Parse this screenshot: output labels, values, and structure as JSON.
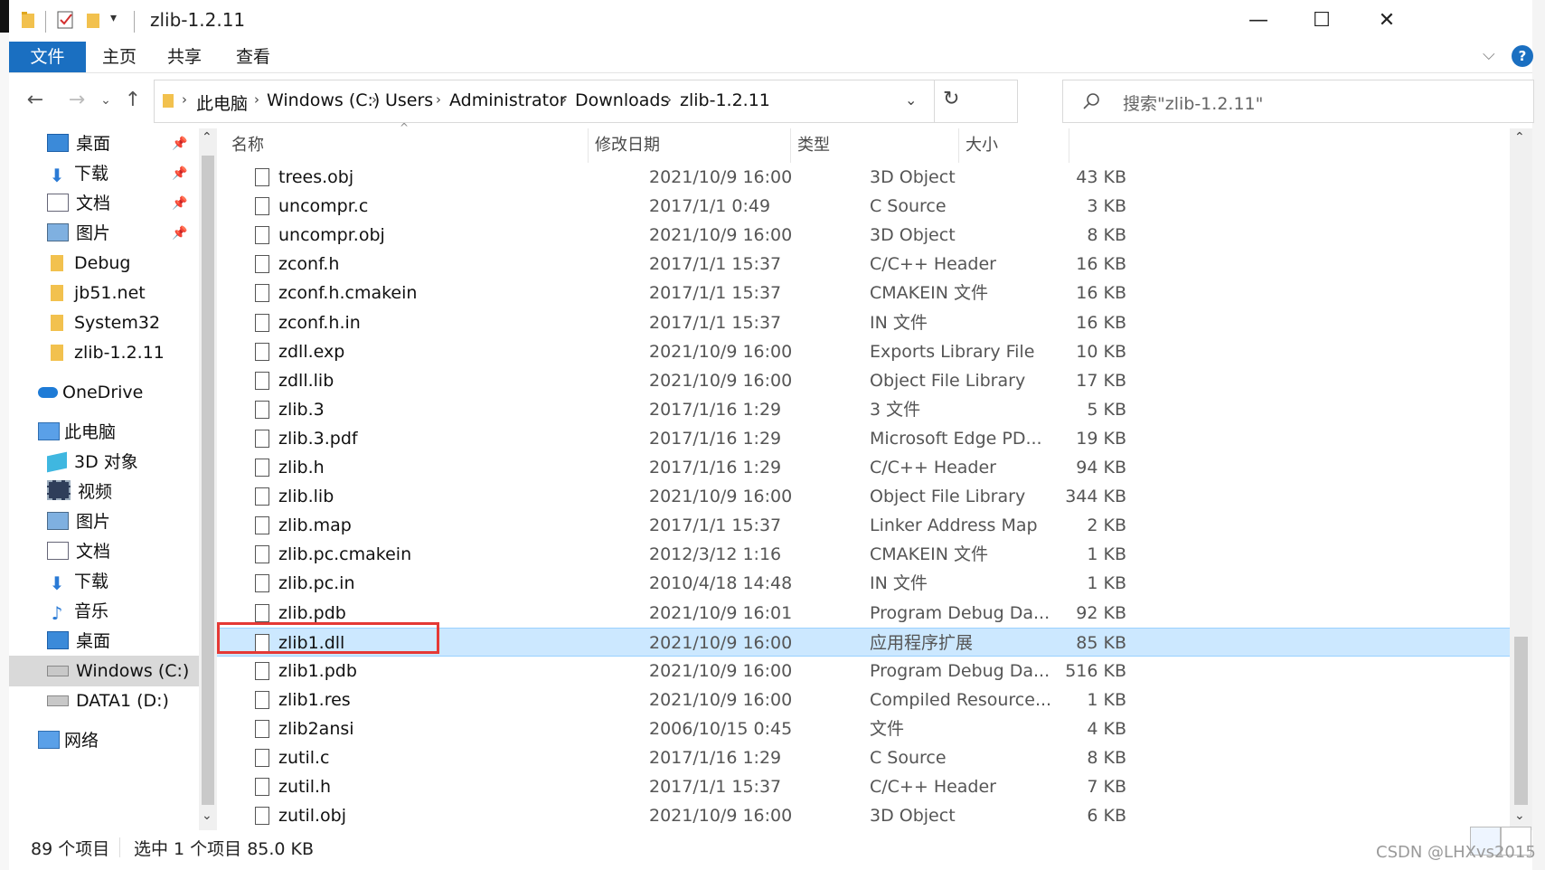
{
  "window": {
    "title": "zlib-1.2.11",
    "controls": {
      "minimize": "—",
      "maximize": "☐",
      "close": "✕"
    }
  },
  "ribbon": {
    "tabs": [
      "文件",
      "主页",
      "共享",
      "查看"
    ],
    "help_label": "?"
  },
  "address": {
    "crumbs": [
      "此电脑",
      "Windows (C:)",
      "Users",
      "Administrator",
      "Downloads",
      "zlib-1.2.11"
    ],
    "search_placeholder": "搜索\"zlib-1.2.11\""
  },
  "nav": {
    "quick_access": [
      {
        "label": "桌面",
        "icon": "desktop-icon",
        "pinned": true
      },
      {
        "label": "下载",
        "icon": "download-icon",
        "pinned": true
      },
      {
        "label": "文档",
        "icon": "document-icon",
        "pinned": true
      },
      {
        "label": "图片",
        "icon": "picture-icon",
        "pinned": true
      },
      {
        "label": "Debug",
        "icon": "folder-icon",
        "pinned": false
      },
      {
        "label": "jb51.net",
        "icon": "folder-icon",
        "pinned": false
      },
      {
        "label": "System32",
        "icon": "folder-icon",
        "pinned": false
      },
      {
        "label": "zlib-1.2.11",
        "icon": "folder-icon",
        "pinned": false
      }
    ],
    "onedrive": "OneDrive",
    "this_pc": "此电脑",
    "pc_items": [
      {
        "label": "3D 对象",
        "icon": "3d-object-icon"
      },
      {
        "label": "视频",
        "icon": "video-icon"
      },
      {
        "label": "图片",
        "icon": "picture-icon"
      },
      {
        "label": "文档",
        "icon": "document-icon"
      },
      {
        "label": "下载",
        "icon": "download-icon"
      },
      {
        "label": "音乐",
        "icon": "music-icon"
      },
      {
        "label": "桌面",
        "icon": "desktop-icon"
      },
      {
        "label": "Windows (C:)",
        "icon": "drive-c-icon"
      },
      {
        "label": "DATA1 (D:)",
        "icon": "drive-d-icon"
      }
    ],
    "network": "网络"
  },
  "columns": {
    "name": "名称",
    "date": "修改日期",
    "type": "类型",
    "size": "大小"
  },
  "files": [
    {
      "name": "trees.obj",
      "date": "2021/10/9 16:00",
      "type": "3D Object",
      "size": "43 KB"
    },
    {
      "name": "uncompr.c",
      "date": "2017/1/1 0:49",
      "type": "C Source",
      "size": "3 KB"
    },
    {
      "name": "uncompr.obj",
      "date": "2021/10/9 16:00",
      "type": "3D Object",
      "size": "8 KB"
    },
    {
      "name": "zconf.h",
      "date": "2017/1/1 15:37",
      "type": "C/C++ Header",
      "size": "16 KB"
    },
    {
      "name": "zconf.h.cmakein",
      "date": "2017/1/1 15:37",
      "type": "CMAKEIN 文件",
      "size": "16 KB"
    },
    {
      "name": "zconf.h.in",
      "date": "2017/1/1 15:37",
      "type": "IN 文件",
      "size": "16 KB"
    },
    {
      "name": "zdll.exp",
      "date": "2021/10/9 16:00",
      "type": "Exports Library File",
      "size": "10 KB"
    },
    {
      "name": "zdll.lib",
      "date": "2021/10/9 16:00",
      "type": "Object File Library",
      "size": "17 KB"
    },
    {
      "name": "zlib.3",
      "date": "2017/1/16 1:29",
      "type": "3 文件",
      "size": "5 KB"
    },
    {
      "name": "zlib.3.pdf",
      "date": "2017/1/16 1:29",
      "type": "Microsoft Edge PD...",
      "size": "19 KB"
    },
    {
      "name": "zlib.h",
      "date": "2017/1/16 1:29",
      "type": "C/C++ Header",
      "size": "94 KB"
    },
    {
      "name": "zlib.lib",
      "date": "2021/10/9 16:00",
      "type": "Object File Library",
      "size": "344 KB"
    },
    {
      "name": "zlib.map",
      "date": "2017/1/1 15:37",
      "type": "Linker Address Map",
      "size": "2 KB"
    },
    {
      "name": "zlib.pc.cmakein",
      "date": "2012/3/12 1:16",
      "type": "CMAKEIN 文件",
      "size": "1 KB"
    },
    {
      "name": "zlib.pc.in",
      "date": "2010/4/18 14:48",
      "type": "IN 文件",
      "size": "1 KB"
    },
    {
      "name": "zlib.pdb",
      "date": "2021/10/9 16:01",
      "type": "Program Debug Da...",
      "size": "92 KB"
    },
    {
      "name": "zlib1.dll",
      "date": "2021/10/9 16:00",
      "type": "应用程序扩展",
      "size": "85 KB",
      "selected": true
    },
    {
      "name": "zlib1.pdb",
      "date": "2021/10/9 16:00",
      "type": "Program Debug Da...",
      "size": "516 KB"
    },
    {
      "name": "zlib1.res",
      "date": "2021/10/9 16:00",
      "type": "Compiled Resource...",
      "size": "1 KB"
    },
    {
      "name": "zlib2ansi",
      "date": "2006/10/15 0:45",
      "type": "文件",
      "size": "4 KB"
    },
    {
      "name": "zutil.c",
      "date": "2017/1/16 1:29",
      "type": "C Source",
      "size": "8 KB"
    },
    {
      "name": "zutil.h",
      "date": "2017/1/1 15:37",
      "type": "C/C++ Header",
      "size": "7 KB"
    },
    {
      "name": "zutil.obj",
      "date": "2021/10/9 16:00",
      "type": "3D Object",
      "size": "6 KB"
    }
  ],
  "status": {
    "count": "89 个项目",
    "selection": "选中 1 个项目  85.0 KB"
  },
  "watermark": "CSDN @LHXvs2015",
  "colors": {
    "accent": "#1a6fc1",
    "selection": "#cce8ff",
    "highlight_box": "#e53935"
  }
}
